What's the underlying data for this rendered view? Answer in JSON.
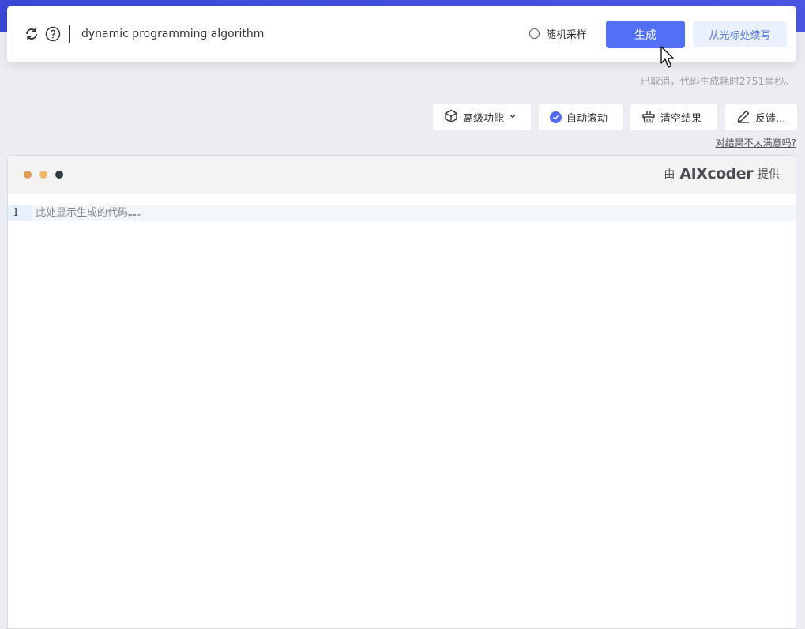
{
  "search": {
    "query": "dynamic programming algorithm",
    "random_sample_label": "随机采样",
    "generate_label": "生成",
    "continue_label": "从光标处续写"
  },
  "status": {
    "message": "已取消，代码生成耗时2751毫秒。"
  },
  "toolbar": {
    "advanced_label": "高级功能",
    "auto_scroll_label": "自动滚动",
    "clear_label": "清空结果",
    "feedback_label": "反馈..."
  },
  "unsatisfied_link": "对结果不太满意吗?",
  "editor": {
    "provided_by_prefix": "由",
    "brand": "AIXcoder",
    "provided_by_suffix": "提供",
    "line_number": "1",
    "placeholder": "此处显示生成的代码……"
  },
  "icons": [
    "refresh-icon",
    "help-icon",
    "radio-icon",
    "cursor-icon",
    "cube-icon",
    "chevron-down-icon",
    "check-icon",
    "basket-icon",
    "pencil-icon"
  ],
  "colors": {
    "accent": "#5270f5",
    "header": "#3a49d8",
    "secondary_bg": "#eaf0fd"
  }
}
